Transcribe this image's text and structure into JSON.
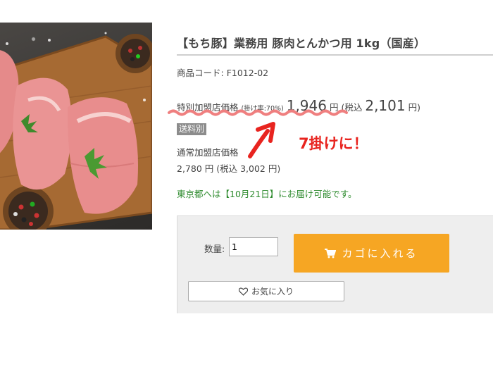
{
  "product": {
    "title": "【もち豚】業務用 豚肉とんかつ用 1kg（国産）",
    "code_label": "商品コード: ",
    "code_value": "F1012-02"
  },
  "special_price": {
    "label": "特別加盟店価格",
    "rate": "(掛け率:70%)",
    "price": "1,946",
    "yen": "円",
    "tax_open": "(税込",
    "tax_price": "2,101",
    "tax_close": "円)"
  },
  "badge": {
    "shipping": "送料別"
  },
  "regular_price": {
    "label": "通常加盟店価格",
    "text": "2,780 円 (税込 3,002 円)"
  },
  "delivery": {
    "text": "東京都へは【10月21日】にお届け可能です。"
  },
  "cart": {
    "quantity_label": "数量:",
    "quantity_value": "1",
    "add_to_cart_label": "カゴに入れる",
    "favorite_label": "お気に入り"
  },
  "annotation": {
    "text": "7掛けに！",
    "color": "#e8241f"
  },
  "colors": {
    "accent_button": "#f6a623",
    "delivery_text": "#2e8b2e",
    "badge_bg": "#8c8c8c"
  },
  "icons": {
    "cart": "cart-icon",
    "favorite": "heart-icon"
  }
}
